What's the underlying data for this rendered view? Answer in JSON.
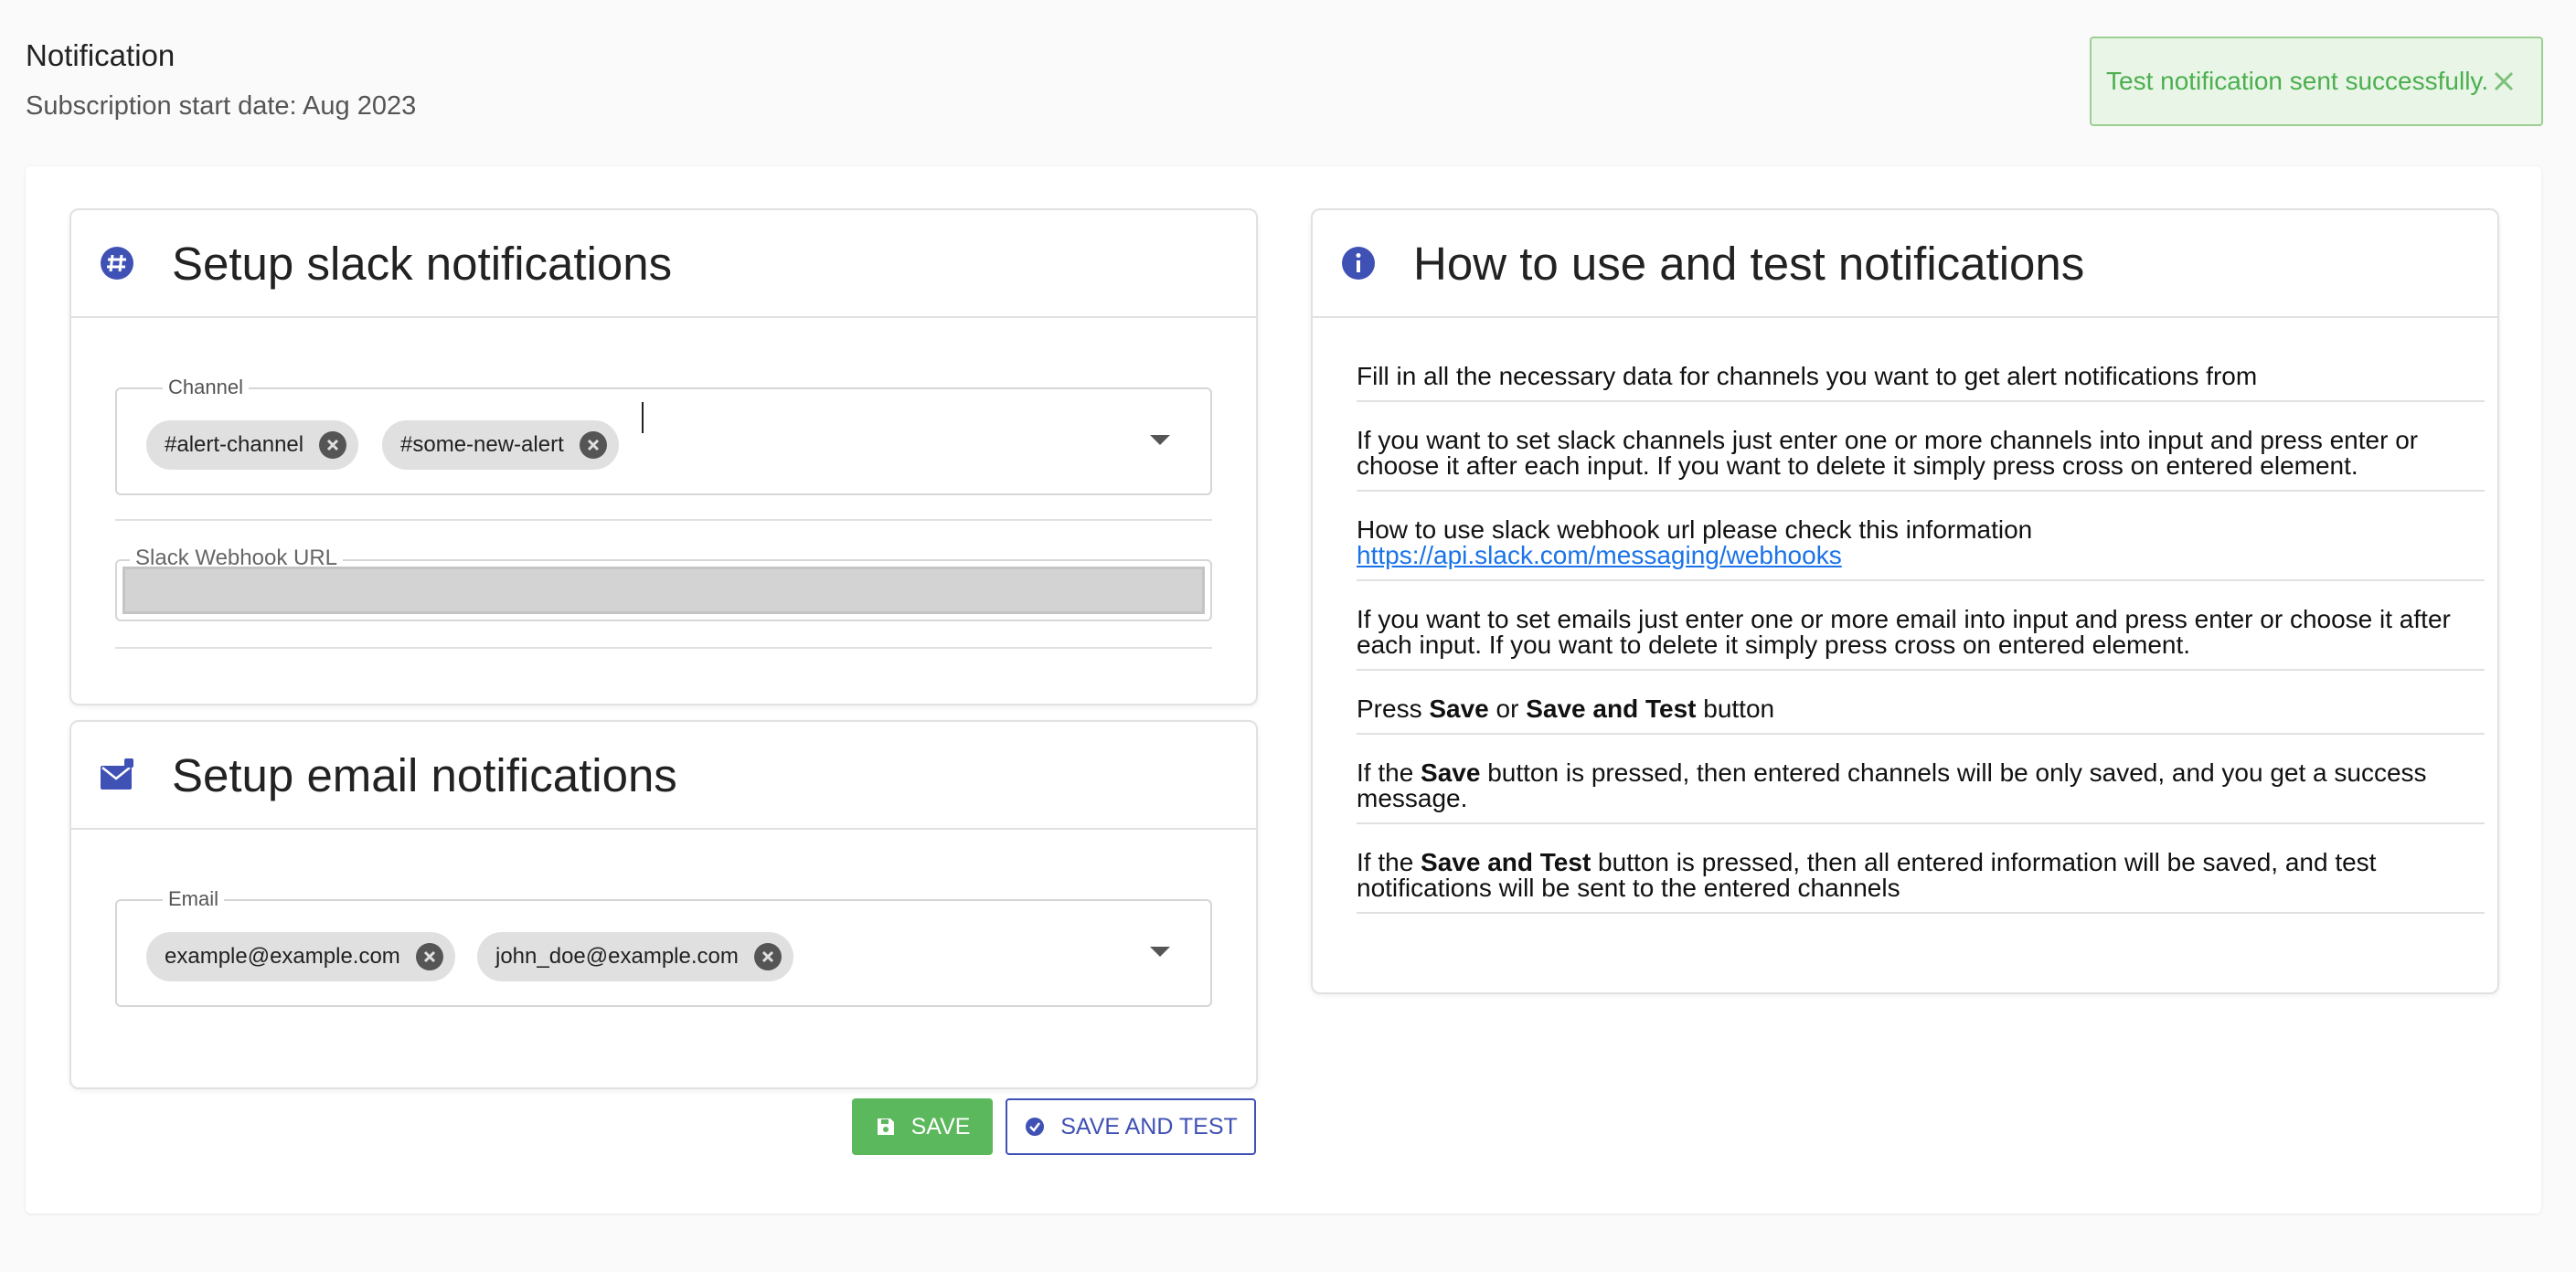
{
  "page": {
    "title": "Notification",
    "subscription": "Subscription start date: Aug 2023"
  },
  "toast": {
    "message": "Test notification sent successfully.",
    "icon": "close-icon"
  },
  "slack_card": {
    "title": "Setup slack notifications",
    "icon": "slack-icon",
    "channel_label": "Channel",
    "channels": [
      "#alert-channel",
      "#some-new-alert"
    ],
    "webhook_label": "Slack Webhook URL",
    "webhook_value": ""
  },
  "email_card": {
    "title": "Setup email notifications",
    "icon": "mail-icon",
    "email_label": "Email",
    "emails": [
      "example@example.com",
      "john_doe@example.com"
    ]
  },
  "buttons": {
    "save": "SAVE",
    "save_and_test": "SAVE AND TEST"
  },
  "info_card": {
    "title": "How to use and test notifications",
    "icon": "info-icon",
    "item1": "Fill in all the necessary data for channels you want to get alert notifications from",
    "item2": "If you want to set slack channels just enter one or more channels into input and press enter or choose it after each input. If you want to delete it simply press cross on entered element.",
    "item3_text": "How to use slack webhook url please check this information",
    "item3_link": "https://api.slack.com/messaging/webhooks",
    "item4": "If you want to set emails just enter one or more email into input and press enter or choose it after each input. If you want to delete it simply press cross on entered element.",
    "item5_pre": "Press ",
    "item5_b1": "Save",
    "item5_mid": " or ",
    "item5_b2": "Save and Test",
    "item5_post": " button",
    "item6_pre": "If the ",
    "item6_b": "Save",
    "item6_post": " button is pressed, then entered channels will be only saved, and you get a success message.",
    "item7_pre": "If the ",
    "item7_b": "Save and Test",
    "item7_post": " button is pressed, then all entered information will be saved, and test notifications will be sent to the entered channels"
  },
  "colors": {
    "accent": "#3f51b5",
    "success": "#5cb85c",
    "toast_bg": "#e9f5e6",
    "link": "#1a73e8"
  }
}
